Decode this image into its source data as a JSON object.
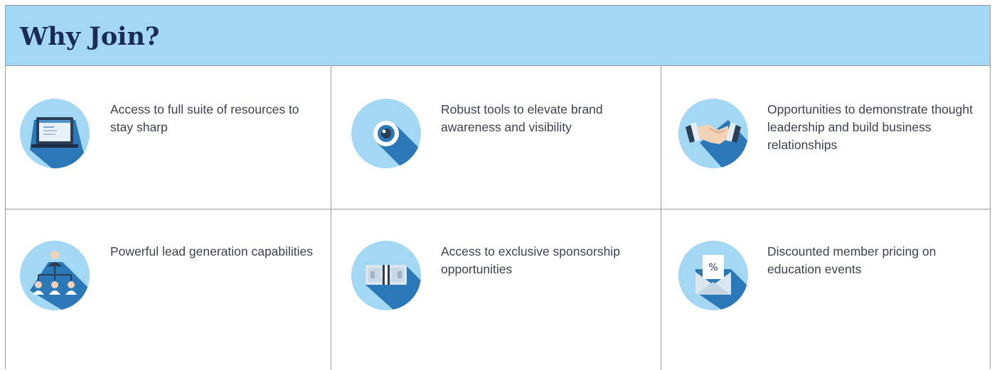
{
  "header": {
    "title": "Why Join?"
  },
  "colors": {
    "header_bg": "#a3d8f4",
    "title": "#1b2b59",
    "icon_circle": "#a3d8f4",
    "icon_shadow": "#2a78b8"
  },
  "benefits": [
    {
      "icon": "laptop-icon",
      "text": "Access to full suite of resources to stay sharp"
    },
    {
      "icon": "eye-icon",
      "text": "Robust tools to elevate brand awareness and visibility"
    },
    {
      "icon": "handshake-icon",
      "text": "Opportunities to demonstrate thought leadership and build business relationships"
    },
    {
      "icon": "org-chart-icon",
      "text": "Powerful lead generation capabilities"
    },
    {
      "icon": "money-icon",
      "text": "Access to exclusive sponsorship opportunities"
    },
    {
      "icon": "discount-envelope-icon",
      "text": "Discounted member pricing on education events"
    }
  ]
}
